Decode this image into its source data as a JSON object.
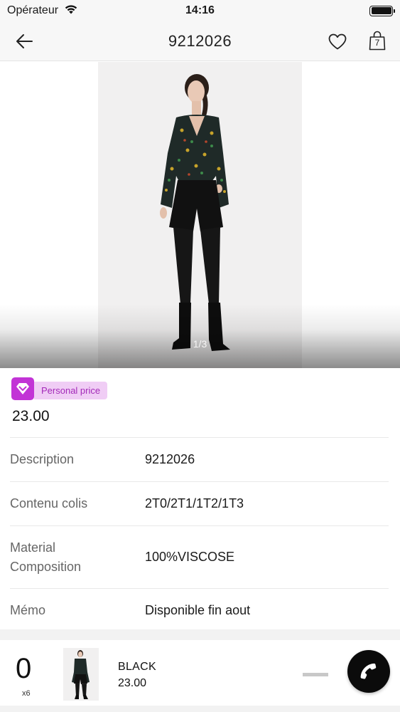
{
  "status_bar": {
    "carrier": "Opérateur",
    "time": "14:16"
  },
  "nav": {
    "title": "9212026",
    "bag_count": "7"
  },
  "gallery": {
    "indicator": "1/3"
  },
  "price": {
    "badge_label": "Personal price",
    "value": "23.00",
    "badge_color": "#c233d6"
  },
  "details": [
    {
      "label": "Description",
      "value": "9212026"
    },
    {
      "label": "Contenu colis",
      "value": "2T0/2T1/1T2/1T3"
    },
    {
      "label": "Material\nComposition",
      "value": "100%VISCOSE"
    },
    {
      "label": "Mémo",
      "value": "Disponible fin aout"
    }
  ],
  "cart_line": {
    "quantity": "0",
    "multiplier": "x6",
    "color": "BLACK",
    "price": "23.00"
  }
}
